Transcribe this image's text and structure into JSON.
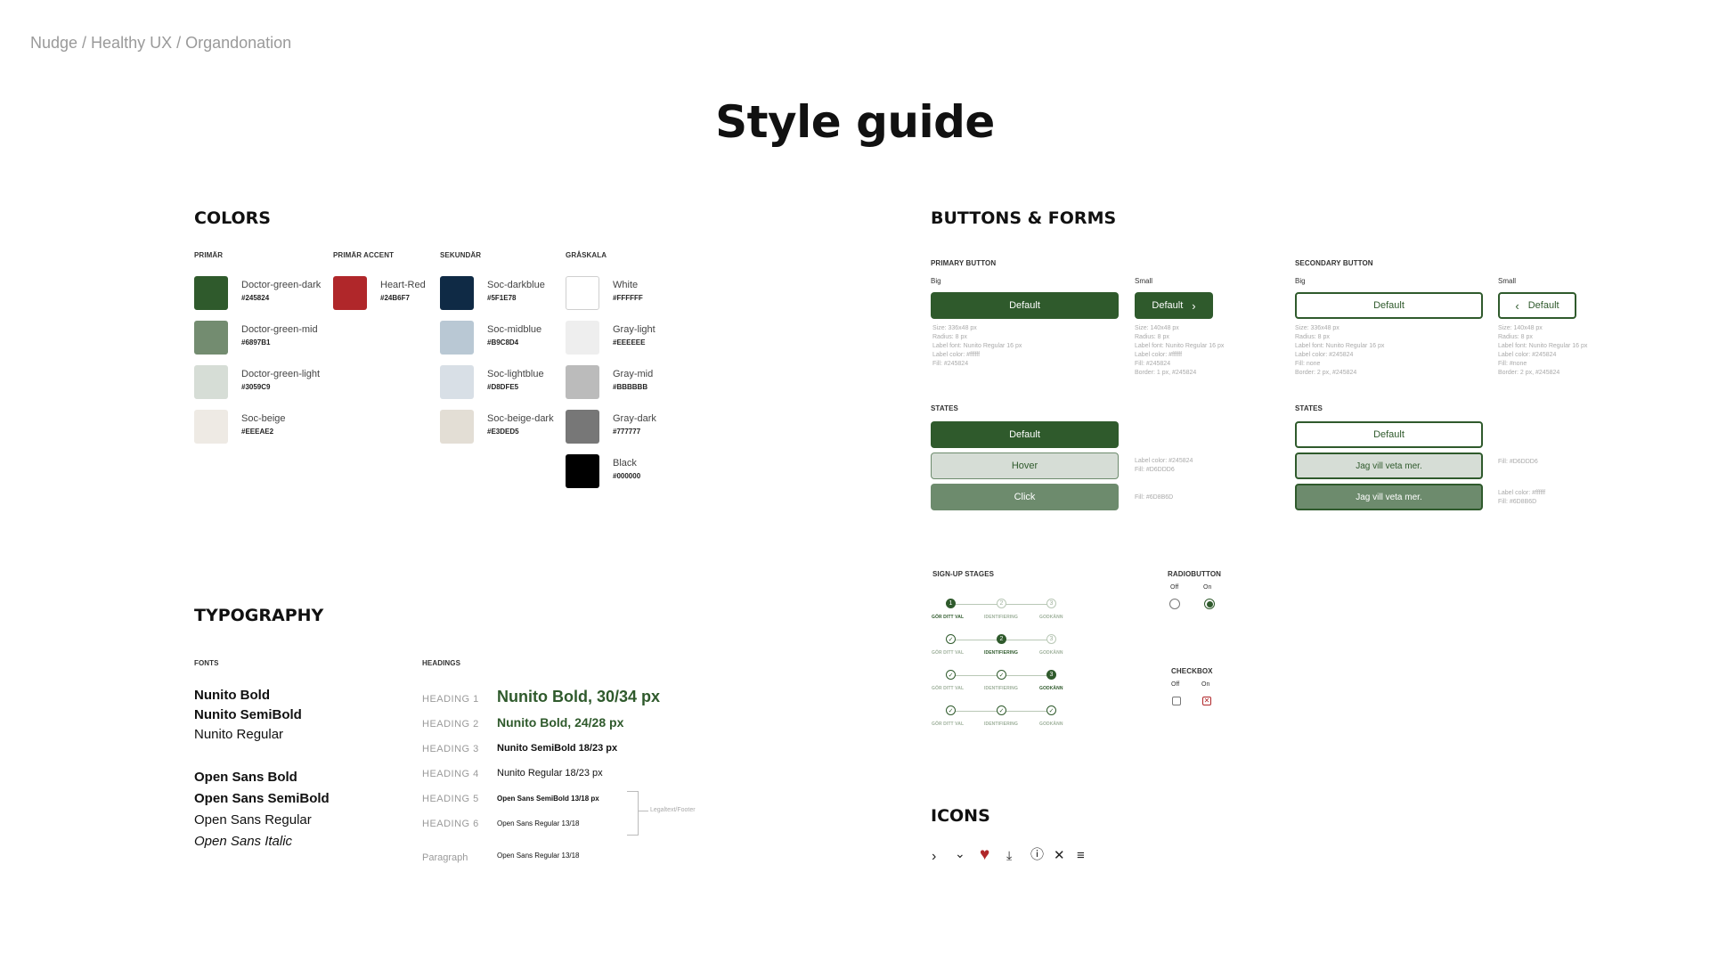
{
  "breadcrumb": "Nudge / Healthy UX / Organdonation",
  "title": "Style guide",
  "colors": {
    "heading": "COLORS",
    "groups": [
      {
        "label": "PRIMÄR",
        "swatches": [
          {
            "name": "Doctor-green-dark",
            "hex": "#245824",
            "color": "#2f5a2c"
          },
          {
            "name": "Doctor-green-mid",
            "hex": "#6897B1",
            "color": "#738c70"
          },
          {
            "name": "Doctor-green-light",
            "hex": "#3059C9",
            "color": "#d6ddd6"
          },
          {
            "name": "Soc-beige",
            "hex": "#EEEAE2",
            "color": "#eeeae4"
          }
        ]
      },
      {
        "label": "PRIMÄR ACCENT",
        "swatches": [
          {
            "name": "Heart-Red",
            "hex": "#24B6F7",
            "color": "#b0272a"
          }
        ]
      },
      {
        "label": "SEKUNDÄR",
        "swatches": [
          {
            "name": "Soc-darkblue",
            "hex": "#5F1E78",
            "color": "#0f2a45"
          },
          {
            "name": "Soc-midblue",
            "hex": "#B9C8D4",
            "color": "#b9c8d4"
          },
          {
            "name": "Soc-lightblue",
            "hex": "#D8DFE5",
            "color": "#d8dfe6"
          },
          {
            "name": "Soc-beige-dark",
            "hex": "#E3DED5",
            "color": "#e3ded5"
          }
        ]
      },
      {
        "label": "GRÅSKALA",
        "swatches": [
          {
            "name": "White",
            "hex": "#FFFFFF",
            "color": "#ffffff"
          },
          {
            "name": "Gray-light",
            "hex": "#EEEEEE",
            "color": "#eeeeee"
          },
          {
            "name": "Gray-mid",
            "hex": "#BBBBBB",
            "color": "#bbbbbb"
          },
          {
            "name": "Gray-dark",
            "hex": "#777777",
            "color": "#777777"
          },
          {
            "name": "Black",
            "hex": "#000000",
            "color": "#000000"
          }
        ]
      }
    ]
  },
  "typography": {
    "heading": "TYPOGRAPHY",
    "fonts_label": "FONTS",
    "headings_label": "HEADINGS",
    "fonts": [
      "Nunito Bold",
      "Nunito SemiBold",
      "Nunito Regular",
      "Open Sans Bold",
      "Open Sans SemiBold",
      "Open Sans Regular",
      "Open Sans Italic"
    ],
    "headings": [
      {
        "label": "HEADING 1",
        "sample": "Nunito Bold, 30/34 px"
      },
      {
        "label": "HEADING 2",
        "sample": "Nunito Bold, 24/28 px"
      },
      {
        "label": "HEADING 3",
        "sample": "Nunito SemiBold 18/23 px"
      },
      {
        "label": "HEADING 4",
        "sample": "Nunito Regular 18/23 px"
      },
      {
        "label": "HEADING 5",
        "sample": "Open Sans SemiBold 13/18 px"
      },
      {
        "label": "HEADING 6",
        "sample": "Open Sans Regular 13/18"
      },
      {
        "label": "Paragraph",
        "sample": "Open Sans Regular 13/18"
      }
    ],
    "bracket_note": "Legaltext/Footer"
  },
  "buttons": {
    "heading": "BUTTONS & FORMS",
    "primary_label": "PRIMARY BUTTON",
    "secondary_label": "SECONDARY BUTTON",
    "big": "Big",
    "small": "Small",
    "default": "Default",
    "specs": {
      "primary_big": [
        "Size: 336x48 px",
        "Radius: 8 px",
        "Label font: Nunito Regular 16 px",
        "Label color: #ffffff",
        "Fill: #245824"
      ],
      "primary_small": [
        "Size: 140x48 px",
        "Radius: 8 px",
        "Label font: Nunito Regular 16 px",
        "Label color: #ffffff",
        "Fill: #245824",
        "Border: 1 px, #245824"
      ],
      "secondary_big": [
        "Size: 336x48 px",
        "Radius: 8 px",
        "Label font: Nunito Regular 16 px",
        "Label color: #245824",
        "Fill: none",
        "Border: 2 px, #245824"
      ],
      "secondary_small": [
        "Size: 140x48 px",
        "Radius: 8 px",
        "Label font: Nunito Regular 16 px",
        "Label color: #245824",
        "Fill: #none",
        "Border: 2 px, #245824"
      ]
    },
    "states_label": "STATES",
    "primary_states": [
      "Default",
      "Hover",
      "Click"
    ],
    "secondary_states": [
      "Default",
      "Jag vill veta mer.",
      "Jag vill veta mer."
    ],
    "state_notes": {
      "primary_hover": [
        "Label color: #245824",
        "Fill: #D6DDD6"
      ],
      "primary_click": [
        "Fill: #6D8B6D"
      ],
      "secondary_hover": [
        "Fill: #D6DDD6"
      ],
      "secondary_click": [
        "Label color: #ffffff",
        "Fill: #6D8B6D"
      ]
    }
  },
  "signup": {
    "label": "SIGN-UP STAGES",
    "steps": [
      "GÖR DITT VAL",
      "IDENTIFIERING",
      "GODKÄNN"
    ]
  },
  "radio": {
    "label": "RADIOBUTTON",
    "off": "Off",
    "on": "On"
  },
  "checkbox": {
    "label": "CHECKBOX",
    "off": "Off",
    "on": "On"
  },
  "icons": {
    "heading": "ICONS",
    "items": [
      "chevron-right-icon",
      "chevron-down-icon",
      "heart-icon",
      "download-icon",
      "info-icon",
      "close-icon",
      "menu-icon"
    ]
  },
  "accent": {
    "green": "#2f5a2c",
    "green_mid": "#738c70",
    "green_light": "#d6ddd6",
    "red": "#b0272a"
  }
}
